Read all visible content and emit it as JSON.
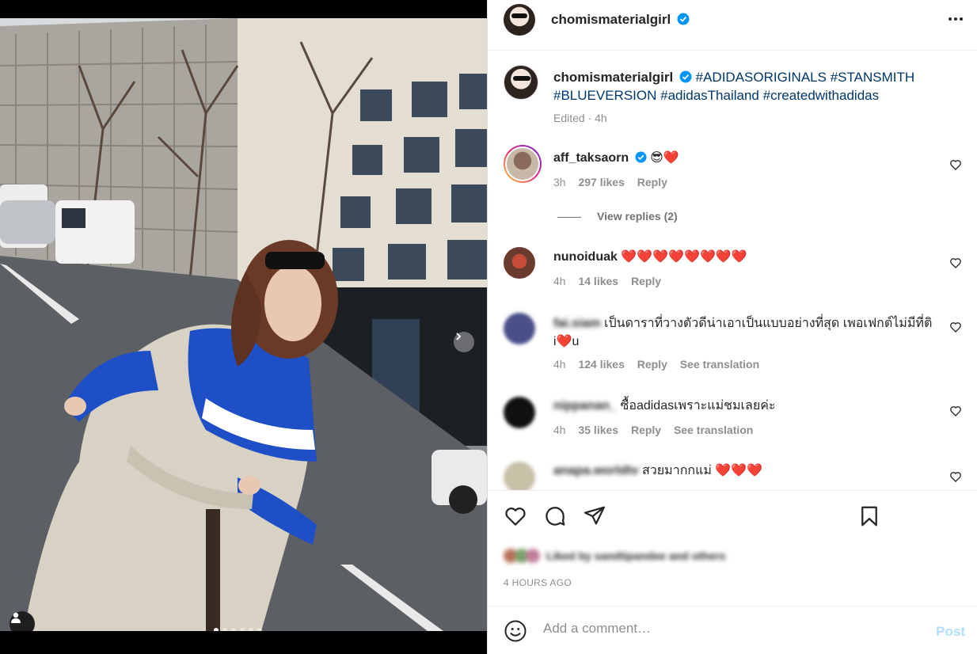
{
  "header": {
    "username": "chomismaterialgirl",
    "more_icon": "more-horizontal-icon"
  },
  "media": {
    "carousel_dots": 6,
    "active_dot": 0
  },
  "caption": {
    "username": "chomismaterialgirl",
    "hashtags": [
      "#ADIDASORIGINALS",
      "#STANSMITH",
      "#BLUEVERSION",
      "#adidasThailand",
      "#createdwithadidas"
    ],
    "meta": "Edited · 4h"
  },
  "comments": [
    {
      "username": "aff_taksaorn",
      "verified": true,
      "text": "😎❤️",
      "time": "3h",
      "likes": "297 likes",
      "reply": "Reply",
      "view_replies": "View replies (2)"
    },
    {
      "username": "nunoiduak",
      "text": "❤️❤️❤️❤️❤️❤️❤️❤️",
      "time": "4h",
      "likes": "14 likes",
      "reply": "Reply"
    },
    {
      "username": "fai.siam",
      "text_line1": "เป็นดาราที่วางตัวดีน่าเอาเป็นแบบอย่างที่สุด เพอเฟกต์ไม่มีที่ติ",
      "text_line2": "i❤️u",
      "time": "4h",
      "likes": "124 likes",
      "reply": "Reply",
      "translation": "See translation"
    },
    {
      "username": "nippanan_",
      "text": "ซื้อadidasเพราะแม่ชมเลยค่ะ",
      "time": "4h",
      "likes": "35 likes",
      "reply": "Reply",
      "translation": "See translation"
    },
    {
      "username": "anapa.worldtv",
      "text": "สวยมากกแม่ ❤️❤️❤️"
    }
  ],
  "actions": {
    "like_icon": "heart-icon",
    "comment_icon": "comment-icon",
    "share_icon": "share-icon",
    "save_icon": "bookmark-icon",
    "liked_by": "Liked by sandtipandee and others",
    "timestamp": "4 HOURS AGO"
  },
  "add_comment": {
    "placeholder": "Add a comment…",
    "post_label": "Post",
    "emoji_icon": "emoji-icon"
  },
  "colors": {
    "link": "#00376b",
    "verified": "#0095f6",
    "post_disabled": "#b2dffc",
    "heart_red": "#ed4956"
  }
}
